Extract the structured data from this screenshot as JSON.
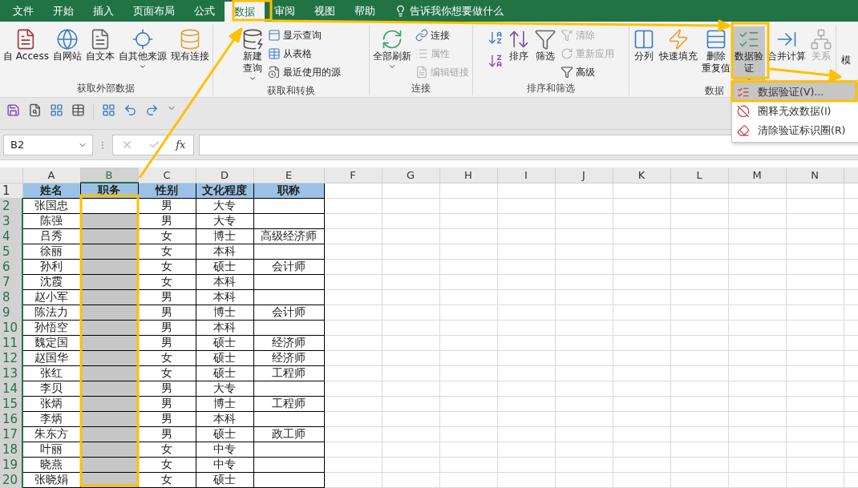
{
  "tabs": [
    {
      "label": "文件",
      "selected": false
    },
    {
      "label": "开始",
      "selected": false
    },
    {
      "label": "插入",
      "selected": false
    },
    {
      "label": "页面布局",
      "selected": false
    },
    {
      "label": "公式",
      "selected": false
    },
    {
      "label": "数据",
      "selected": true
    },
    {
      "label": "审阅",
      "selected": false
    },
    {
      "label": "视图",
      "selected": false
    },
    {
      "label": "帮助",
      "selected": false
    }
  ],
  "tell_me": "告诉我你想要做什么",
  "ribbon_groups": [
    {
      "label": "获取外部数据",
      "items": [
        {
          "kind": "large",
          "lines": [
            "自 Access"
          ],
          "disabled": false,
          "dropdown": false,
          "pressed": false
        },
        {
          "kind": "large",
          "lines": [
            "自网站"
          ],
          "disabled": false,
          "dropdown": false,
          "pressed": false
        },
        {
          "kind": "large",
          "lines": [
            "自文本"
          ],
          "disabled": false,
          "dropdown": false,
          "pressed": false
        },
        {
          "kind": "large",
          "lines": [
            "自其他来源"
          ],
          "disabled": false,
          "dropdown": true,
          "pressed": false
        },
        {
          "kind": "large",
          "lines": [
            "现有连接"
          ],
          "disabled": false,
          "dropdown": false,
          "pressed": false
        }
      ]
    },
    {
      "label": "获取和转换",
      "items": [
        {
          "kind": "large",
          "lines": [
            "新建",
            "查询"
          ],
          "disabled": false,
          "dropdown": true,
          "pressed": false
        },
        {
          "kind": "small",
          "lines": [
            "显示查询"
          ],
          "disabled": false
        },
        {
          "kind": "small",
          "lines": [
            "从表格"
          ],
          "disabled": false
        },
        {
          "kind": "small",
          "lines": [
            "最近使用的源"
          ],
          "disabled": false
        }
      ]
    },
    {
      "label": "连接",
      "items": [
        {
          "kind": "large",
          "lines": [
            "全部刷新"
          ],
          "disabled": false,
          "dropdown": true,
          "pressed": false
        },
        {
          "kind": "small",
          "lines": [
            "连接"
          ],
          "disabled": false
        },
        {
          "kind": "small",
          "lines": [
            "属性"
          ],
          "disabled": true
        },
        {
          "kind": "small",
          "lines": [
            "编辑链接"
          ],
          "disabled": true
        }
      ]
    },
    {
      "label": "排序和筛选",
      "items": [
        {
          "kind": "icon",
          "disabled": false
        },
        {
          "kind": "icon",
          "disabled": false
        },
        {
          "kind": "large",
          "lines": [
            "排序"
          ],
          "disabled": false,
          "dropdown": false,
          "pressed": false
        },
        {
          "kind": "large",
          "lines": [
            "筛选"
          ],
          "disabled": false,
          "dropdown": false,
          "pressed": false
        },
        {
          "kind": "small",
          "lines": [
            "清除"
          ],
          "disabled": true
        },
        {
          "kind": "small",
          "lines": [
            "重新应用"
          ],
          "disabled": true
        },
        {
          "kind": "small",
          "lines": [
            "高级"
          ],
          "disabled": false
        }
      ]
    },
    {
      "label": "数据",
      "items": [
        {
          "kind": "large",
          "lines": [
            "分列"
          ],
          "disabled": false,
          "dropdown": false,
          "pressed": false
        },
        {
          "kind": "large",
          "lines": [
            "快速填充"
          ],
          "disabled": false,
          "dropdown": false,
          "pressed": false
        },
        {
          "kind": "large",
          "lines": [
            "删除",
            "重复值"
          ],
          "disabled": false,
          "dropdown": false,
          "pressed": false
        },
        {
          "kind": "large",
          "lines": [
            "数据验",
            "证"
          ],
          "disabled": false,
          "dropdown": true,
          "pressed": true
        },
        {
          "kind": "large",
          "lines": [
            "合并计算"
          ],
          "disabled": false,
          "dropdown": false,
          "pressed": false
        },
        {
          "kind": "large",
          "lines": [
            "关系"
          ],
          "disabled": true,
          "dropdown": false,
          "pressed": false
        }
      ]
    }
  ],
  "ribbon_overflow": "模",
  "menu": [
    {
      "label": "数据验证(V)...",
      "selected": true
    },
    {
      "label": "圈释无效数据(I)",
      "selected": false
    },
    {
      "label": "清除验证标识圈(R)",
      "selected": false
    }
  ],
  "formula_bar": {
    "name_box": "B2",
    "fx": "fx"
  },
  "columns": [
    {
      "label": "A",
      "selected": false
    },
    {
      "label": "B",
      "selected": true
    },
    {
      "label": "C",
      "selected": false
    },
    {
      "label": "D",
      "selected": false
    },
    {
      "label": "E",
      "selected": false
    },
    {
      "label": "F",
      "selected": false
    },
    {
      "label": "G",
      "selected": false
    },
    {
      "label": "H",
      "selected": false
    },
    {
      "label": "I",
      "selected": false
    },
    {
      "label": "J",
      "selected": false
    },
    {
      "label": "K",
      "selected": false
    },
    {
      "label": "L",
      "selected": false
    },
    {
      "label": "M",
      "selected": false
    },
    {
      "label": "N",
      "selected": false
    }
  ],
  "rows": [
    {
      "number": "1",
      "kind": "header",
      "selected": false,
      "cells": {
        "A": "姓名",
        "B": "职务",
        "C": "性别",
        "D": "文化程度",
        "E": "职称"
      }
    },
    {
      "number": "2",
      "kind": "data",
      "selected": true,
      "cells": {
        "A": "张国忠",
        "C": "男",
        "D": "大专"
      }
    },
    {
      "number": "3",
      "kind": "data",
      "selected": true,
      "cells": {
        "A": "陈强",
        "C": "男",
        "D": "大专"
      }
    },
    {
      "number": "4",
      "kind": "data",
      "selected": true,
      "cells": {
        "A": "吕秀",
        "C": "女",
        "D": "博士",
        "E": "高级经济师"
      }
    },
    {
      "number": "5",
      "kind": "data",
      "selected": true,
      "cells": {
        "A": "徐丽",
        "C": "女",
        "D": "本科"
      }
    },
    {
      "number": "6",
      "kind": "data",
      "selected": true,
      "cells": {
        "A": "孙利",
        "C": "女",
        "D": "硕士",
        "E": "会计师"
      }
    },
    {
      "number": "7",
      "kind": "data",
      "selected": true,
      "cells": {
        "A": "沈霞",
        "C": "女",
        "D": "本科"
      }
    },
    {
      "number": "8",
      "kind": "data",
      "selected": true,
      "cells": {
        "A": "赵小军",
        "C": "男",
        "D": "本科"
      }
    },
    {
      "number": "9",
      "kind": "data",
      "selected": true,
      "cells": {
        "A": "陈法力",
        "C": "男",
        "D": "博士",
        "E": "会计师"
      }
    },
    {
      "number": "10",
      "kind": "data",
      "selected": true,
      "cells": {
        "A": "孙悟空",
        "C": "男",
        "D": "本科"
      }
    },
    {
      "number": "11",
      "kind": "data",
      "selected": true,
      "cells": {
        "A": "魏定国",
        "C": "男",
        "D": "硕士",
        "E": "经济师"
      }
    },
    {
      "number": "12",
      "kind": "data",
      "selected": true,
      "cells": {
        "A": "赵国华",
        "C": "女",
        "D": "硕士",
        "E": "经济师"
      }
    },
    {
      "number": "13",
      "kind": "data",
      "selected": true,
      "cells": {
        "A": "张红",
        "C": "女",
        "D": "硕士",
        "E": "工程师"
      }
    },
    {
      "number": "14",
      "kind": "data",
      "selected": true,
      "cells": {
        "A": "李贝",
        "C": "男",
        "D": "大专"
      }
    },
    {
      "number": "15",
      "kind": "data",
      "selected": true,
      "cells": {
        "A": "张炳",
        "C": "男",
        "D": "博士",
        "E": "工程师"
      }
    },
    {
      "number": "16",
      "kind": "data",
      "selected": true,
      "cells": {
        "A": "李炳",
        "C": "男",
        "D": "本科"
      }
    },
    {
      "number": "17",
      "kind": "data",
      "selected": true,
      "cells": {
        "A": "朱东方",
        "C": "男",
        "D": "硕士",
        "E": "政工师"
      }
    },
    {
      "number": "18",
      "kind": "data",
      "selected": true,
      "cells": {
        "A": "叶丽",
        "C": "女",
        "D": "中专"
      }
    },
    {
      "number": "19",
      "kind": "data",
      "selected": true,
      "cells": {
        "A": "晓燕",
        "C": "女",
        "D": "中专"
      }
    },
    {
      "number": "20",
      "kind": "data",
      "selected": true,
      "cells": {
        "A": "张晓娟",
        "C": "女",
        "D": "硕士"
      }
    }
  ]
}
